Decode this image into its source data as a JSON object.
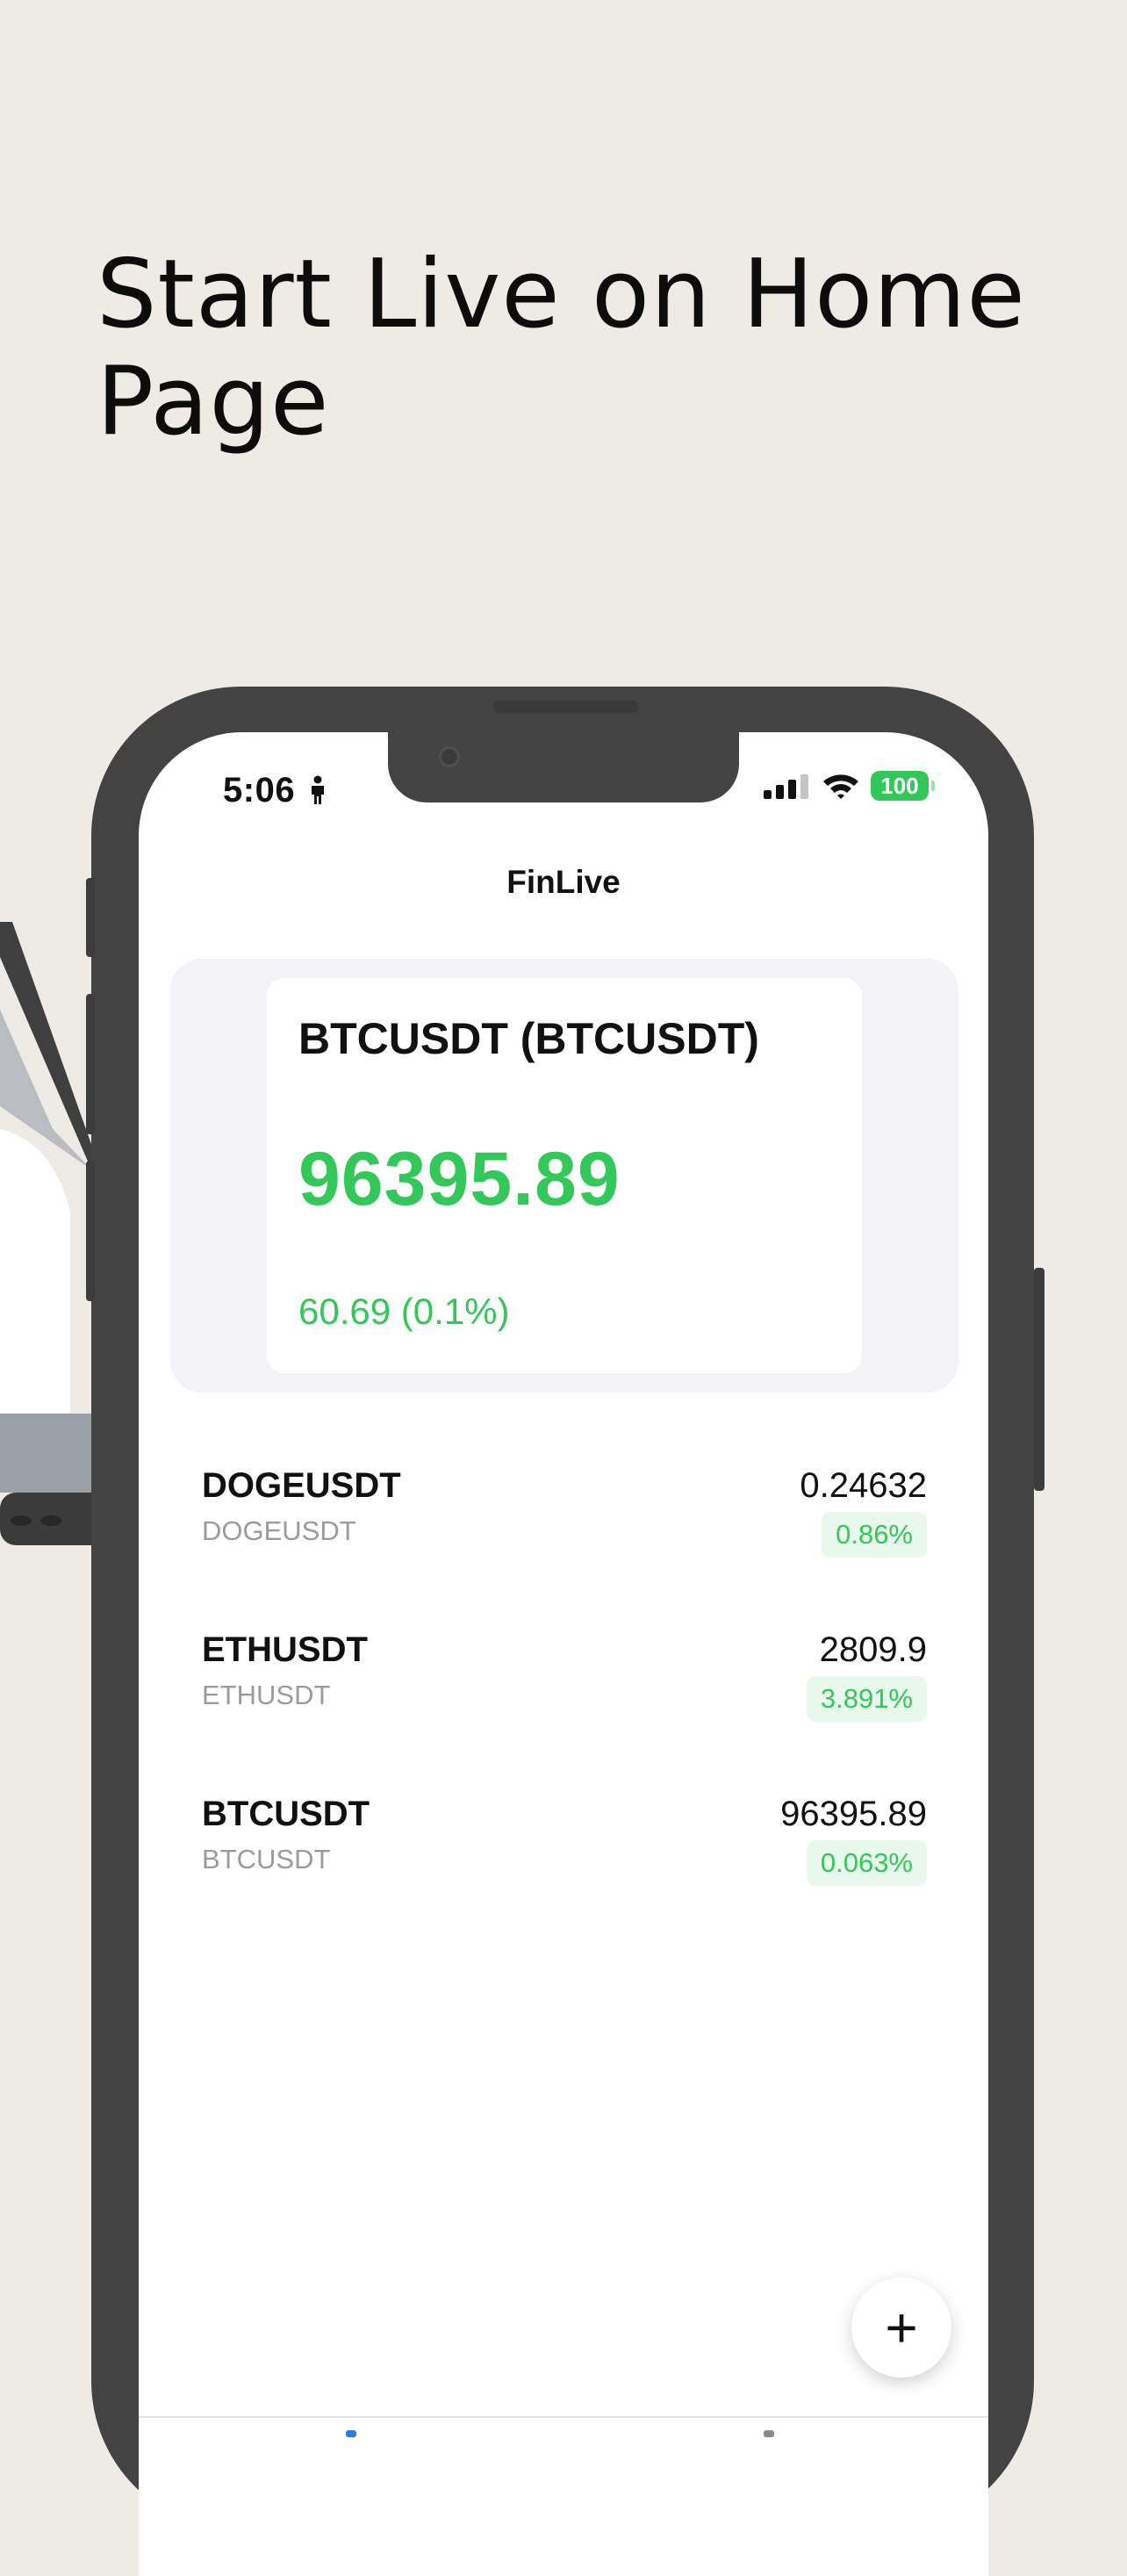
{
  "headline": "Start Live on Home Page",
  "status_bar": {
    "time": "5:06",
    "battery": "100"
  },
  "app": {
    "title": "FinLive",
    "featured": {
      "name": "BTCUSDT (BTCUSDT)",
      "price": "96395.89",
      "change": "60.69 (0.1%)"
    },
    "list": [
      {
        "symbol": "DOGEUSDT",
        "sub": "DOGEUSDT",
        "price": "0.24632",
        "change": "0.86%"
      },
      {
        "symbol": "ETHUSDT",
        "sub": "ETHUSDT",
        "price": "2809.9",
        "change": "3.891%"
      },
      {
        "symbol": "BTCUSDT",
        "sub": "BTCUSDT",
        "price": "96395.89",
        "change": "0.063%"
      }
    ],
    "fab_label": "+"
  },
  "colors": {
    "positive": "#34C759",
    "background": "#EEEBE6",
    "frame": "#434343"
  },
  "icons": [
    "person-icon",
    "cellular-signal-icon",
    "wifi-icon",
    "battery-icon",
    "plus-icon"
  ]
}
